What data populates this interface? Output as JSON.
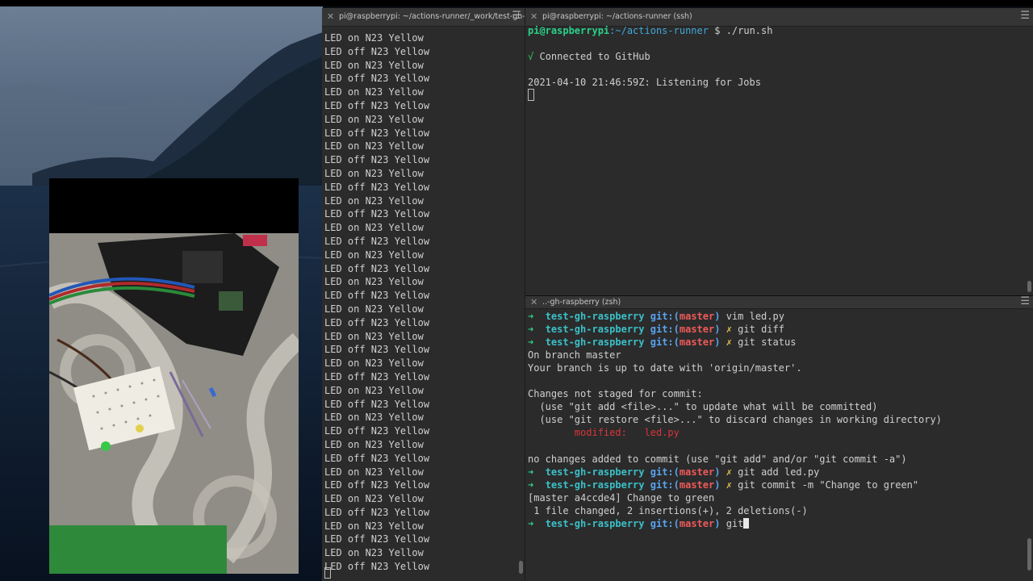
{
  "desktop": {
    "wallpaper": "catalina-island"
  },
  "left_terminal": {
    "tab_title": "pi@raspberrypi: ~/actions-runner/_work/test-gh-",
    "lines": [
      "LED on N23 Yellow",
      "LED off N23 Yellow",
      "LED on N23 Yellow",
      "LED off N23 Yellow",
      "LED on N23 Yellow",
      "LED off N23 Yellow",
      "LED on N23 Yellow",
      "LED off N23 Yellow",
      "LED on N23 Yellow",
      "LED off N23 Yellow",
      "LED on N23 Yellow",
      "LED off N23 Yellow",
      "LED on N23 Yellow",
      "LED off N23 Yellow",
      "LED on N23 Yellow",
      "LED off N23 Yellow",
      "LED on N23 Yellow",
      "LED off N23 Yellow",
      "LED on N23 Yellow",
      "LED off N23 Yellow",
      "LED on N23 Yellow",
      "LED off N23 Yellow",
      "LED on N23 Yellow",
      "LED off N23 Yellow",
      "LED on N23 Yellow",
      "LED off N23 Yellow",
      "LED on N23 Yellow",
      "LED off N23 Yellow",
      "LED on N23 Yellow",
      "LED off N23 Yellow",
      "LED on N23 Yellow",
      "LED off N23 Yellow",
      "LED on N23 Yellow",
      "LED off N23 Yellow",
      "LED on N23 Yellow",
      "LED off N23 Yellow",
      "LED on N23 Yellow",
      "LED off N23 Yellow",
      "LED on N23 Yellow",
      "LED off N23 Yellow"
    ]
  },
  "ssh_terminal": {
    "tab_title": "pi@raspberrypi: ~/actions-runner (ssh)",
    "prompt_user": "pi@raspberrypi",
    "prompt_path": ":~/actions-runner",
    "prompt_symbol": "$",
    "command": "./run.sh",
    "check_mark": "√",
    "connected": "Connected to GitHub",
    "listening": "2021-04-10 21:46:59Z: Listening for Jobs"
  },
  "zsh_terminal": {
    "tab_title": "..-gh-raspberry (zsh)",
    "arrow": "➜",
    "dir": "test-gh-raspberry",
    "git_prefix": "git:(",
    "branch": "master",
    "git_suffix": ")",
    "dirty_mark": "✗",
    "cmd1": "vim led.py",
    "cmd2": "git diff",
    "cmd3": "git status",
    "status_line1": "On branch master",
    "status_line2": "Your branch is up to date with 'origin/master'.",
    "status_line3": "Changes not staged for commit:",
    "status_line4": "  (use \"git add <file>...\" to update what will be committed)",
    "status_line5": "  (use \"git restore <file>...\" to discard changes in working directory)",
    "modified_label": "        modified:   ",
    "modified_file": "led.py",
    "status_line6": "no changes added to commit (use \"git add\" and/or \"git commit -a\")",
    "cmd4": "git add led.py",
    "cmd5": "git commit -m \"Change to green\"",
    "commit_line1": "[master a4ccde4] Change to green",
    "commit_line2": " 1 file changed, 2 insertions(+), 2 deletions(-)",
    "cmd6": "git"
  },
  "colors": {
    "terminal_bg": "#2b2b2b",
    "prompt_green": "#2bd18a",
    "branch_red": "#ee5a5a",
    "dirty_yellow": "#e5c04d",
    "modified_red": "#d9343b"
  }
}
